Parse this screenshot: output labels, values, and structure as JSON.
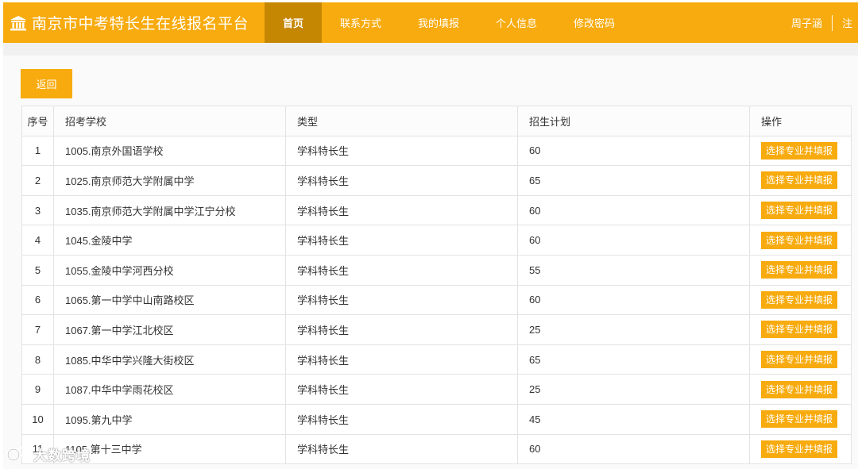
{
  "header": {
    "brand": "南京市中考特长生在线报名平台",
    "brand_icon": "institution-icon",
    "nav": [
      {
        "label": "首页",
        "active": true
      },
      {
        "label": "联系方式",
        "active": false
      },
      {
        "label": "我的填报",
        "active": false
      },
      {
        "label": "个人信息",
        "active": false
      },
      {
        "label": "修改密码",
        "active": false
      }
    ],
    "user_name": "周子涵",
    "logout_partial": "注"
  },
  "colors": {
    "accent": "#f8ab0e",
    "accent_dark": "#c58602"
  },
  "back_button": "返回",
  "table": {
    "headers": [
      "序号",
      "招考学校",
      "类型",
      "招生计划",
      "操作"
    ],
    "action_label": "选择专业并填报",
    "rows": [
      {
        "no": "1",
        "school": "1005.南京外国语学校",
        "type": "学科特长生",
        "plan": "60"
      },
      {
        "no": "2",
        "school": "1025.南京师范大学附属中学",
        "type": "学科特长生",
        "plan": "65"
      },
      {
        "no": "3",
        "school": "1035.南京师范大学附属中学江宁分校",
        "type": "学科特长生",
        "plan": "60"
      },
      {
        "no": "4",
        "school": "1045.金陵中学",
        "type": "学科特长生",
        "plan": "60"
      },
      {
        "no": "5",
        "school": "1055.金陵中学河西分校",
        "type": "学科特长生",
        "plan": "55"
      },
      {
        "no": "6",
        "school": "1065.第一中学中山南路校区",
        "type": "学科特长生",
        "plan": "60"
      },
      {
        "no": "7",
        "school": "1067.第一中学江北校区",
        "type": "学科特长生",
        "plan": "25"
      },
      {
        "no": "8",
        "school": "1085.中华中学兴隆大街校区",
        "type": "学科特长生",
        "plan": "65"
      },
      {
        "no": "9",
        "school": "1087.中华中学雨花校区",
        "type": "学科特长生",
        "plan": "25"
      },
      {
        "no": "10",
        "school": "1095.第九中学",
        "type": "学科特长生",
        "plan": "45"
      },
      {
        "no": "11",
        "school": "1105.第十三中学",
        "type": "学科特长生",
        "plan": "60"
      }
    ]
  },
  "watermark": "大数跨境"
}
